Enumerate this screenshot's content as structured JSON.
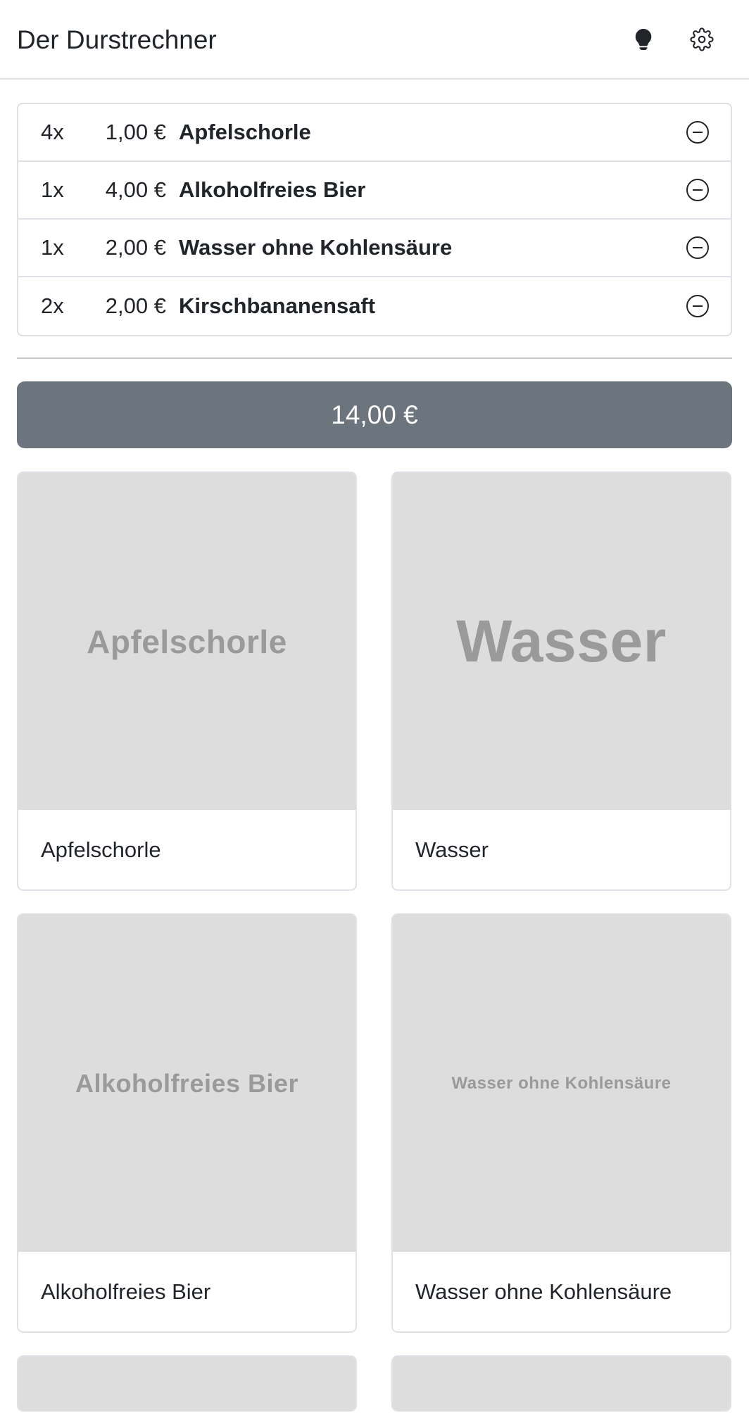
{
  "app": {
    "title": "Der Durstrechner"
  },
  "header": {
    "theme_icon": "lightbulb-icon",
    "settings_icon": "gear-icon"
  },
  "order": {
    "items": [
      {
        "qty": "4x",
        "price": "1,00 €",
        "name": "Apfelschorle"
      },
      {
        "qty": "1x",
        "price": "4,00 €",
        "name": "Alkoholfreies Bier"
      },
      {
        "qty": "1x",
        "price": "2,00 €",
        "name": "Wasser ohne Kohlensäure"
      },
      {
        "qty": "2x",
        "price": "2,00 €",
        "name": "Kirschbananensaft"
      }
    ],
    "remove_icon": "minus-circle-icon"
  },
  "total": {
    "label": "14,00 €"
  },
  "products": [
    {
      "image_text": "Apfelschorle",
      "label": "Apfelschorle"
    },
    {
      "image_text": "Wasser",
      "label": "Wasser"
    },
    {
      "image_text": "Alkoholfreies Bier",
      "label": "Alkoholfreies Bier"
    },
    {
      "image_text": "Wasser ohne Kohlensäure",
      "label": "Wasser ohne Kohlensäure"
    }
  ],
  "colors": {
    "total_button_bg": "#6c757d",
    "placeholder_bg": "#dddddd",
    "placeholder_text": "#9a9a9a",
    "border": "#dee2e6"
  }
}
